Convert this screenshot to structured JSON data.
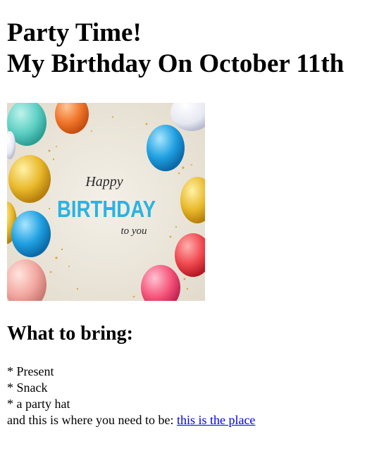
{
  "heading": {
    "line1": "Party Time!",
    "line2": "My Birthday On October 11th"
  },
  "banner": {
    "script_top": "Happy",
    "main_word": "BIRTHDAY",
    "script_bottom": "to you",
    "text_color": "#29b3e3",
    "background_color": "#eee8dd",
    "balloon_colors": [
      "#5fd0c4",
      "#f0762a",
      "#1f9fe0",
      "#e9b82a",
      "#f0474e",
      "#f5557a",
      "#f2a7a0"
    ]
  },
  "bring": {
    "title": "What to bring:",
    "items": [
      "* Present",
      "* Snack",
      "* a party hat"
    ]
  },
  "location": {
    "prefix": "and this is where you need to be: ",
    "link_text": "this is the place"
  },
  "colors": {
    "link": "#0000ee"
  }
}
